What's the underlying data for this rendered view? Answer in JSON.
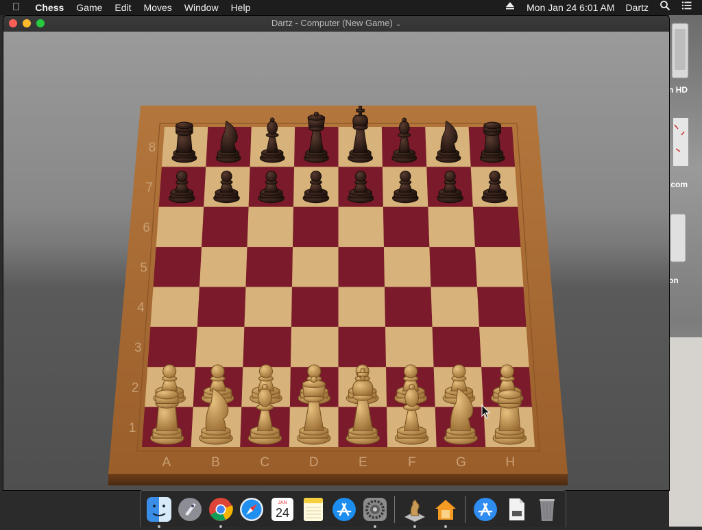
{
  "menubar": {
    "apple": "",
    "app_name": "Chess",
    "items": [
      "Game",
      "Edit",
      "Moves",
      "Window",
      "Help"
    ],
    "datetime": "Mon Jan 24  6:01 AM",
    "user": "Dartz"
  },
  "desktop": {
    "labels": [
      "n HD",
      ".com",
      "on"
    ]
  },
  "window": {
    "title": "Dartz - Computer   (New Game)",
    "chevron": "⌄"
  },
  "board": {
    "files": [
      "A",
      "B",
      "C",
      "D",
      "E",
      "F",
      "G",
      "H"
    ],
    "ranks": [
      "8",
      "7",
      "6",
      "5",
      "4",
      "3",
      "2",
      "1"
    ],
    "light_square": "#d7b27a",
    "dark_square": "#7a1a2b",
    "frame": "#a56a34",
    "black_piece": "#2a1b16",
    "white_piece": "#c99a55",
    "back_rank": [
      "rook",
      "knight",
      "bishop",
      "queen",
      "king",
      "bishop",
      "knight",
      "rook"
    ]
  },
  "dock": {
    "items": [
      {
        "name": "Finder",
        "icon": "finder-icon",
        "running": true
      },
      {
        "name": "Launchpad",
        "icon": "launchpad-icon",
        "running": false
      },
      {
        "name": "Google Chrome",
        "icon": "chrome-icon",
        "running": true
      },
      {
        "name": "Safari",
        "icon": "safari-icon",
        "running": false
      },
      {
        "name": "Calendar",
        "icon": "calendar-icon",
        "running": false,
        "month": "JAN",
        "day": "24"
      },
      {
        "name": "Notes",
        "icon": "notes-icon",
        "running": false
      },
      {
        "name": "App Store",
        "icon": "app-store-icon",
        "running": false
      },
      {
        "name": "System Preferences",
        "icon": "system-preferences-icon",
        "running": true
      },
      {
        "name": "Chess",
        "icon": "chess-icon",
        "running": true
      },
      {
        "name": "Home",
        "icon": "home-icon",
        "running": true
      },
      {
        "name": "Downloads",
        "icon": "downloads-icon",
        "running": false
      },
      {
        "name": "Document",
        "icon": "document-icon",
        "running": false
      },
      {
        "name": "Trash",
        "icon": "trash-icon",
        "running": false
      }
    ]
  }
}
